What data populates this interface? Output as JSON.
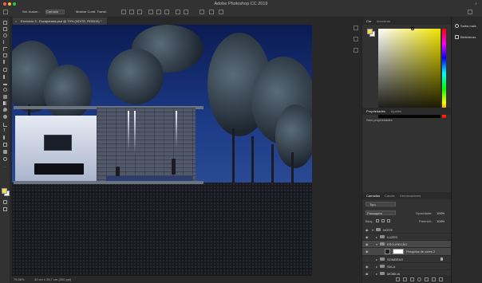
{
  "app": {
    "title": "Adobe Photoshop CC 2019"
  },
  "options_bar": {
    "auto_select_label": "Sel. Autom.:",
    "auto_select_value": "Camada",
    "transform_label": "Mostrar Contr. Transf."
  },
  "document": {
    "tab_title": "Exercicio 3 - Escaparada.psd @ 79% (NOITE, RGB/16) *",
    "close_symbol": "×",
    "zoom": "79,56%",
    "dimensions": "42 cm x 26,7 cm (300 ppi)"
  },
  "color_panel": {
    "tabs": [
      "Cor",
      "Amostras"
    ],
    "active_tab": "Cor",
    "foreground": "#f0e050",
    "background": "#ffffff"
  },
  "properties_panel": {
    "tabs": [
      "Propriedades",
      "Ajustes"
    ],
    "empty_text": "Sem propriedades"
  },
  "layers_panel": {
    "tabs": [
      "Camadas",
      "Canais",
      "Demarcadores"
    ],
    "filter_label": "Tipo",
    "blend_mode": "Passagem",
    "opacity_label": "Opacidade:",
    "opacity_value": "100%",
    "lock_label": "Bloq.:",
    "fill_label": "Preench.:",
    "fill_value": "100%",
    "layers": [
      {
        "name": "NOITE",
        "type": "group",
        "level": 0,
        "expanded": true,
        "visible": true
      },
      {
        "name": "LUZES",
        "type": "group",
        "level": 1,
        "expanded": false,
        "visible": true
      },
      {
        "name": "ESCURECÃO",
        "type": "group",
        "level": 1,
        "expanded": true,
        "visible": true
      },
      {
        "name": "Pesquisa de cores 2",
        "type": "adjustment",
        "level": 2,
        "visible": true
      },
      {
        "name": "SOMBRAS",
        "type": "group",
        "level": 1,
        "expanded": false,
        "visible": false
      },
      {
        "name": "SALA",
        "type": "group",
        "level": 1,
        "expanded": false,
        "visible": true
      },
      {
        "name": "MOBILIA",
        "type": "group",
        "level": 1,
        "expanded": false,
        "visible": true
      }
    ]
  },
  "right_dock": {
    "items": [
      "Saiba mais",
      "Bibliotecas"
    ]
  }
}
